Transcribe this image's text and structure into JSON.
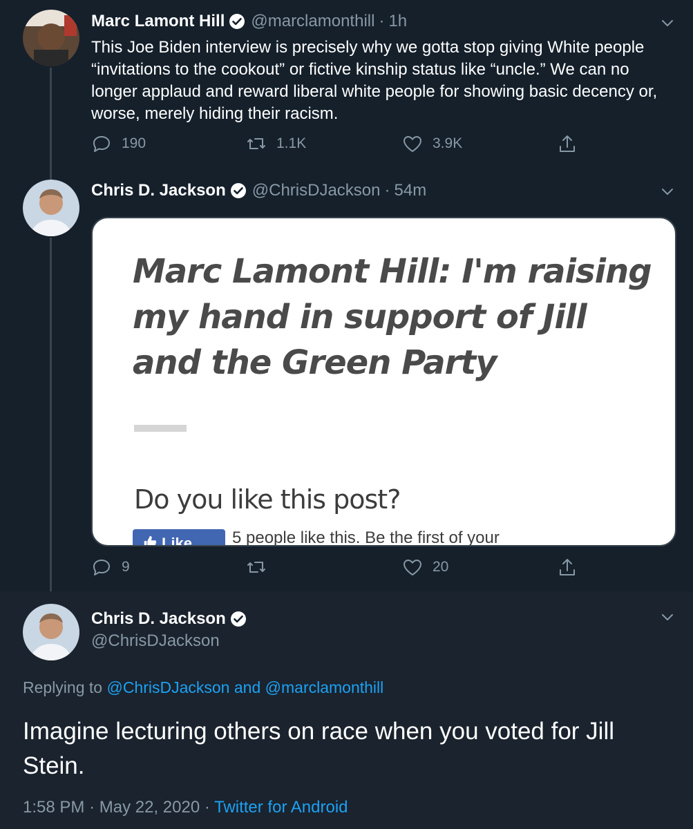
{
  "tweets": [
    {
      "name": "Marc Lamont Hill",
      "handle": "@marclamonthill",
      "separator": "·",
      "time": "1h",
      "text": "This Joe Biden interview is precisely why we gotta stop giving White people “invitations to the cookout” or fictive kinship status like “uncle.” We can no longer applaud and reward liberal white people for showing basic decency or, worse, merely hiding their racism.",
      "replies": "190",
      "retweets": "1.1K",
      "likes": "3.9K"
    },
    {
      "name": "Chris D. Jackson",
      "handle": "@ChrisDJackson",
      "separator": "·",
      "time": "54m",
      "card": {
        "headline": "Marc Lamont Hill: I'm raising my hand in support of Jill and the Green Party",
        "question": "Do you like this post?",
        "like_button": "Like",
        "like_count_text": "5 people like this. Be the first of your"
      },
      "replies": "9",
      "retweets": "",
      "likes": "20"
    },
    {
      "name": "Chris D. Jackson",
      "handle": "@ChrisDJackson",
      "replying_prefix": "Replying to",
      "replying_user_1": "@ChrisDJackson",
      "replying_and": "and",
      "replying_user_2": "@marclamonthill",
      "text": "Imagine lecturing others on race when you voted for Jill Stein.",
      "time": "1:58 PM",
      "separator_1": "·",
      "date": "May 22, 2020",
      "separator_2": "·",
      "source": "Twitter for Android"
    }
  ],
  "colors": {
    "background": "#15202b",
    "text": "#ffffff",
    "secondary": "#8899a6",
    "link": "#1da1f2",
    "divider": "#38444d"
  },
  "icons": [
    "verified-badge-icon",
    "chevron-down-icon",
    "reply-icon",
    "retweet-icon",
    "like-icon",
    "share-icon",
    "thumbs-up-icon"
  ]
}
